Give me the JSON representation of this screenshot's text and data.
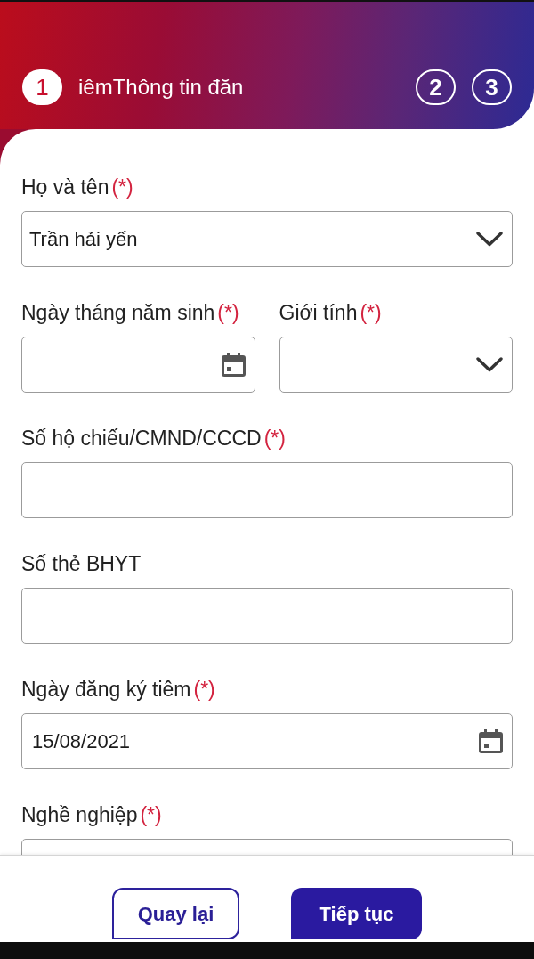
{
  "header": {
    "steps": [
      {
        "label": "1",
        "selected": true
      },
      {
        "label": "2",
        "selected": false
      },
      {
        "label": "3",
        "selected": false
      }
    ],
    "title": "iêmThông tin đăn"
  },
  "form": {
    "rows": [
      [
        {
          "label": "Họ và tên",
          "mark": "(*)",
          "kind": "select",
          "value": "Trần hải yến"
        }
      ],
      [
        {
          "label": "Ngày tháng năm sinh",
          "mark": "(*)",
          "kind": "date"
        },
        {
          "label": "Giới tính",
          "mark": "(*)",
          "kind": "select"
        }
      ],
      [
        {
          "label": "Số hộ chiếu/CMND/CCCD",
          "mark": "(*)",
          "kind": "text"
        }
      ],
      [
        {
          "label": "Số thẻ BHYT",
          "kind": "text"
        }
      ],
      [
        {
          "label": "Ngày đăng ký tiêm",
          "mark": "(*)",
          "kind": "date",
          "value": "15/08/2021"
        }
      ],
      [
        {
          "label": "Nghề nghiệp",
          "mark": "(*)",
          "kind": "text"
        }
      ]
    ]
  },
  "footer": {
    "buttons": [
      {
        "label": "Quay lại",
        "kind": "secondary"
      },
      {
        "label": "Tiếp tục",
        "kind": "primary"
      }
    ]
  }
}
